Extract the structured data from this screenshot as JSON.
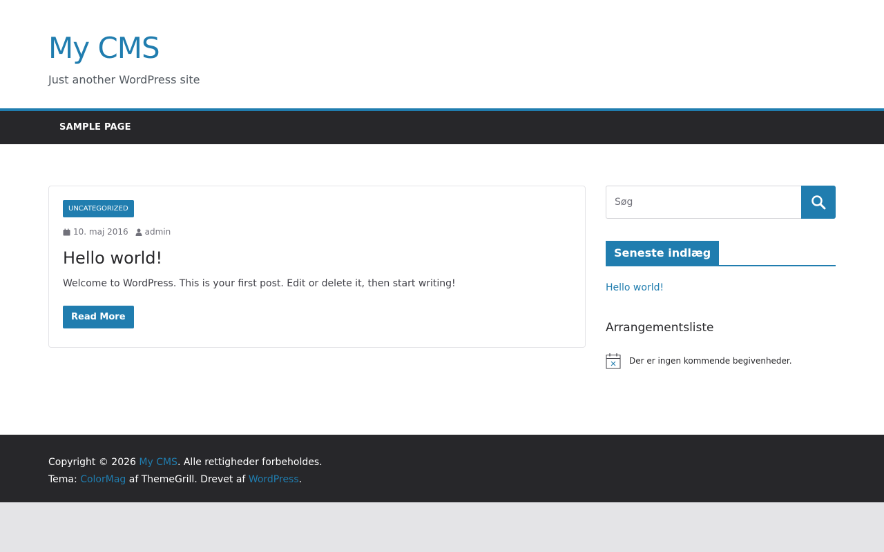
{
  "header": {
    "site_title": "My CMS",
    "tagline": "Just another WordPress site"
  },
  "nav": {
    "items": [
      {
        "label": "SAMPLE PAGE"
      }
    ]
  },
  "post": {
    "category": "UNCATEGORIZED",
    "date": "10. maj 2016",
    "author": "admin",
    "title": "Hello world!",
    "excerpt": "Welcome to WordPress. This is your first post. Edit or delete it, then start writing!",
    "read_more": "Read More"
  },
  "sidebar": {
    "search": {
      "placeholder": "Søg"
    },
    "recent_posts": {
      "title": "Seneste indlæg",
      "items": [
        {
          "label": "Hello world!"
        }
      ]
    },
    "events": {
      "title": "Arrangementsliste",
      "empty_text": "Der er ingen kommende begivenheder."
    }
  },
  "footer": {
    "copyright_prefix": "Copyright © 2026",
    "site_link": "My CMS",
    "rights": ". Alle rettigheder forbeholdes.",
    "theme_prefix": "Tema:",
    "theme_link": "ColorMag",
    "theme_by": "af ThemeGrill. Drevet af",
    "wp_link": "WordPress",
    "end": "."
  },
  "colors": {
    "accent": "#207daf",
    "dark": "#27272a",
    "background": "#e4e4e7"
  },
  "icons": [
    "calendar-icon",
    "user-icon",
    "search-icon",
    "calendar-empty-icon"
  ]
}
